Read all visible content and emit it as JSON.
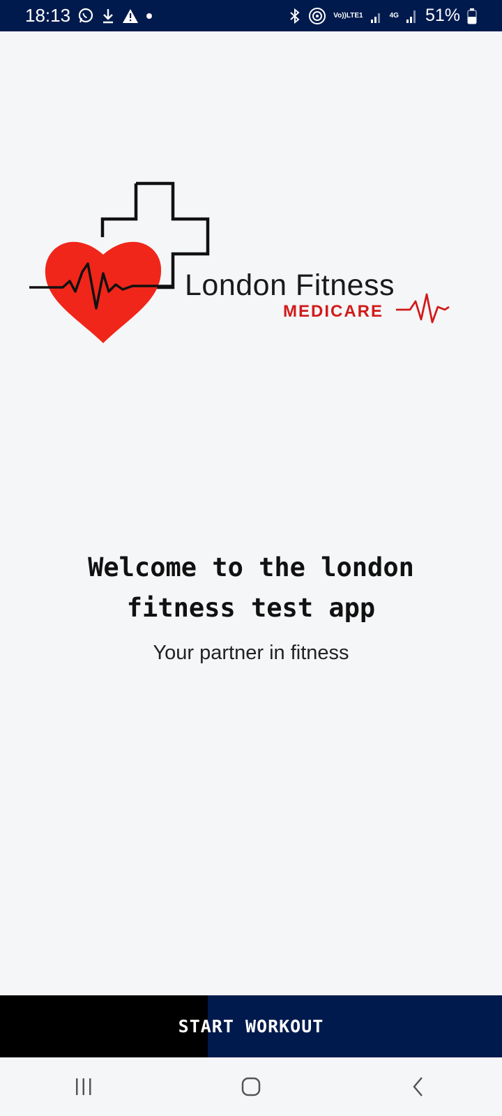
{
  "status_bar": {
    "time": "18:13",
    "battery_percent": "51%",
    "volte_label_top": "Vo))",
    "volte_label_bottom": "LTE1",
    "network_label": "4G",
    "icons": [
      "whatsapp-icon",
      "download-icon",
      "warning-icon",
      "dot-icon",
      "bluetooth-icon",
      "hotspot-icon",
      "signal-icon",
      "signal-icon",
      "battery-icon"
    ]
  },
  "logo": {
    "title": "London Fitness",
    "subtitle": "MEDICARE",
    "heart_color": "#f0261a",
    "accent_red": "#d11a1a"
  },
  "welcome": {
    "line1": "Welcome to the london",
    "line2": "fitness test app",
    "tagline": "Your partner in fitness"
  },
  "start_button": {
    "label": "START WORKOUT"
  },
  "colors": {
    "status_bar_bg": "#001a4d",
    "button_navy": "#001a4d",
    "button_black": "#000000",
    "page_bg": "#f5f6f8"
  },
  "nav_bar": {
    "buttons": [
      "recent-apps-icon",
      "home-icon",
      "back-icon"
    ]
  }
}
